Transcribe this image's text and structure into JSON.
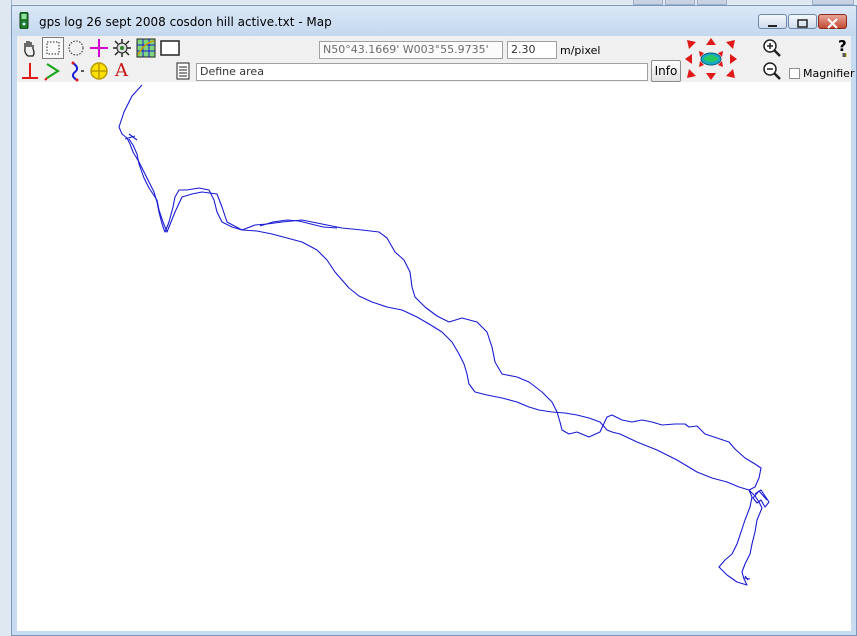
{
  "window": {
    "title": "gps log 26 sept 2008 cosdon hill active.txt - Map"
  },
  "toolbar": {
    "coordinates": "N50°43.1669' W003°55.9735'",
    "scale_value": "2.30",
    "scale_unit": "m/pixel",
    "status_text": "Define area",
    "info_label": "Info",
    "magnifier_label": "Magnifier",
    "text_tool_glyph": "A",
    "help_glyph": "?"
  },
  "icons": [
    "hand-pan-icon",
    "rect-select-icon",
    "ellipse-select-icon",
    "crosshair-icon",
    "gear-settings-icon",
    "grid-map-icon",
    "blank-frame-icon",
    "perpendicular-icon",
    "route-arrow-icon",
    "track-segment-icon",
    "target-icon",
    "text-tool-icon",
    "list-document-icon",
    "pan-arrows-icon",
    "zoom-in-icon",
    "zoom-out-icon",
    "help-icon"
  ],
  "colors": {
    "track": "#1a1ad6",
    "window_frame": "#c7dbf1",
    "close_button": "#c44b35"
  },
  "magnifier_checked": false
}
